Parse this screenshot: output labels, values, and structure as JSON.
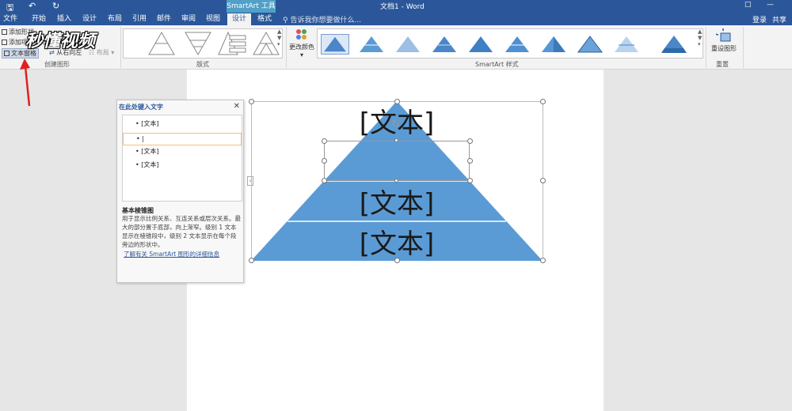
{
  "titlebar": {
    "context_tab": "SmartArt 工具",
    "doc_title": "文档1 - Word"
  },
  "tabs": [
    {
      "label": "文件"
    },
    {
      "label": "开始"
    },
    {
      "label": "插入"
    },
    {
      "label": "设计"
    },
    {
      "label": "布局"
    },
    {
      "label": "引用"
    },
    {
      "label": "邮件"
    },
    {
      "label": "审阅"
    },
    {
      "label": "视图"
    },
    {
      "label": "设计"
    },
    {
      "label": "格式"
    }
  ],
  "tellme": "告诉我你想要做什么...",
  "account": {
    "login": "登录",
    "share": "共享"
  },
  "ribbon": {
    "create": {
      "add_shape": "添加形状",
      "add_bullet": "添加项目符号",
      "text_pane": "文本窗格",
      "rtl": "从右向左",
      "layout": "布局",
      "group_label": "创建图形"
    },
    "layouts_label": "版式",
    "change_colors": "更改颜色",
    "styles_label": "SmartArt 样式",
    "reset_graphic": "重设图形",
    "reset_label": "重置"
  },
  "watermark": "秒懂视频",
  "text_pane": {
    "title": "在此处键入文字",
    "items": [
      "[文本]",
      "",
      "[文本]",
      "[文本]"
    ],
    "desc_title": "基本棱锥图",
    "desc": "用于显示比例关系、互连关系或层次关系。最大的部分置于底部，向上渐窄。级别 1 文本显示在棱锥段中，级别 2 文本显示在每个段旁边的形状中。",
    "link": "了解有关 SmartArt 图形的详细信息"
  },
  "pyramid": {
    "tiers": [
      "[文本]",
      "[文本]",
      "[文本]"
    ],
    "fill": "#5b9bd5"
  },
  "colors": {
    "brand": "#2b579a",
    "accent": "#5b9bd5",
    "annotation": "#e02020"
  }
}
